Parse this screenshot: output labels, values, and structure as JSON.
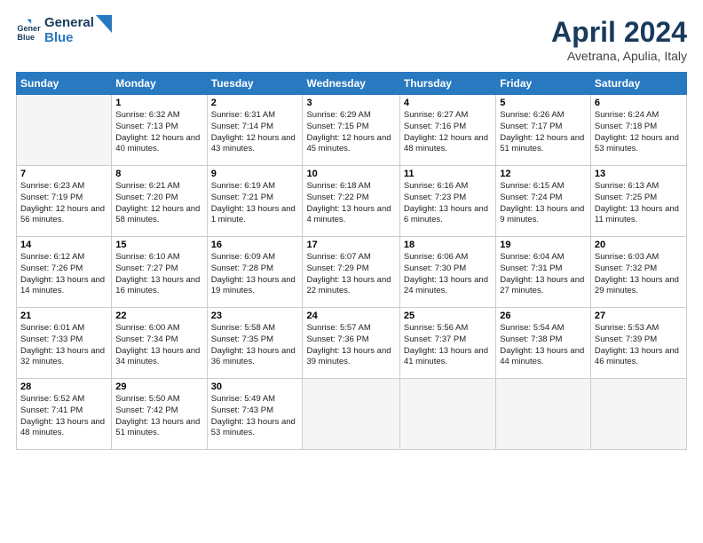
{
  "header": {
    "logo_line1": "General",
    "logo_line2": "Blue",
    "month": "April 2024",
    "location": "Avetrana, Apulia, Italy"
  },
  "columns": [
    "Sunday",
    "Monday",
    "Tuesday",
    "Wednesday",
    "Thursday",
    "Friday",
    "Saturday"
  ],
  "weeks": [
    [
      {
        "num": "",
        "sunrise": "",
        "sunset": "",
        "daylight": ""
      },
      {
        "num": "1",
        "sunrise": "Sunrise: 6:32 AM",
        "sunset": "Sunset: 7:13 PM",
        "daylight": "Daylight: 12 hours and 40 minutes."
      },
      {
        "num": "2",
        "sunrise": "Sunrise: 6:31 AM",
        "sunset": "Sunset: 7:14 PM",
        "daylight": "Daylight: 12 hours and 43 minutes."
      },
      {
        "num": "3",
        "sunrise": "Sunrise: 6:29 AM",
        "sunset": "Sunset: 7:15 PM",
        "daylight": "Daylight: 12 hours and 45 minutes."
      },
      {
        "num": "4",
        "sunrise": "Sunrise: 6:27 AM",
        "sunset": "Sunset: 7:16 PM",
        "daylight": "Daylight: 12 hours and 48 minutes."
      },
      {
        "num": "5",
        "sunrise": "Sunrise: 6:26 AM",
        "sunset": "Sunset: 7:17 PM",
        "daylight": "Daylight: 12 hours and 51 minutes."
      },
      {
        "num": "6",
        "sunrise": "Sunrise: 6:24 AM",
        "sunset": "Sunset: 7:18 PM",
        "daylight": "Daylight: 12 hours and 53 minutes."
      }
    ],
    [
      {
        "num": "7",
        "sunrise": "Sunrise: 6:23 AM",
        "sunset": "Sunset: 7:19 PM",
        "daylight": "Daylight: 12 hours and 56 minutes."
      },
      {
        "num": "8",
        "sunrise": "Sunrise: 6:21 AM",
        "sunset": "Sunset: 7:20 PM",
        "daylight": "Daylight: 12 hours and 58 minutes."
      },
      {
        "num": "9",
        "sunrise": "Sunrise: 6:19 AM",
        "sunset": "Sunset: 7:21 PM",
        "daylight": "Daylight: 13 hours and 1 minute."
      },
      {
        "num": "10",
        "sunrise": "Sunrise: 6:18 AM",
        "sunset": "Sunset: 7:22 PM",
        "daylight": "Daylight: 13 hours and 4 minutes."
      },
      {
        "num": "11",
        "sunrise": "Sunrise: 6:16 AM",
        "sunset": "Sunset: 7:23 PM",
        "daylight": "Daylight: 13 hours and 6 minutes."
      },
      {
        "num": "12",
        "sunrise": "Sunrise: 6:15 AM",
        "sunset": "Sunset: 7:24 PM",
        "daylight": "Daylight: 13 hours and 9 minutes."
      },
      {
        "num": "13",
        "sunrise": "Sunrise: 6:13 AM",
        "sunset": "Sunset: 7:25 PM",
        "daylight": "Daylight: 13 hours and 11 minutes."
      }
    ],
    [
      {
        "num": "14",
        "sunrise": "Sunrise: 6:12 AM",
        "sunset": "Sunset: 7:26 PM",
        "daylight": "Daylight: 13 hours and 14 minutes."
      },
      {
        "num": "15",
        "sunrise": "Sunrise: 6:10 AM",
        "sunset": "Sunset: 7:27 PM",
        "daylight": "Daylight: 13 hours and 16 minutes."
      },
      {
        "num": "16",
        "sunrise": "Sunrise: 6:09 AM",
        "sunset": "Sunset: 7:28 PM",
        "daylight": "Daylight: 13 hours and 19 minutes."
      },
      {
        "num": "17",
        "sunrise": "Sunrise: 6:07 AM",
        "sunset": "Sunset: 7:29 PM",
        "daylight": "Daylight: 13 hours and 22 minutes."
      },
      {
        "num": "18",
        "sunrise": "Sunrise: 6:06 AM",
        "sunset": "Sunset: 7:30 PM",
        "daylight": "Daylight: 13 hours and 24 minutes."
      },
      {
        "num": "19",
        "sunrise": "Sunrise: 6:04 AM",
        "sunset": "Sunset: 7:31 PM",
        "daylight": "Daylight: 13 hours and 27 minutes."
      },
      {
        "num": "20",
        "sunrise": "Sunrise: 6:03 AM",
        "sunset": "Sunset: 7:32 PM",
        "daylight": "Daylight: 13 hours and 29 minutes."
      }
    ],
    [
      {
        "num": "21",
        "sunrise": "Sunrise: 6:01 AM",
        "sunset": "Sunset: 7:33 PM",
        "daylight": "Daylight: 13 hours and 32 minutes."
      },
      {
        "num": "22",
        "sunrise": "Sunrise: 6:00 AM",
        "sunset": "Sunset: 7:34 PM",
        "daylight": "Daylight: 13 hours and 34 minutes."
      },
      {
        "num": "23",
        "sunrise": "Sunrise: 5:58 AM",
        "sunset": "Sunset: 7:35 PM",
        "daylight": "Daylight: 13 hours and 36 minutes."
      },
      {
        "num": "24",
        "sunrise": "Sunrise: 5:57 AM",
        "sunset": "Sunset: 7:36 PM",
        "daylight": "Daylight: 13 hours and 39 minutes."
      },
      {
        "num": "25",
        "sunrise": "Sunrise: 5:56 AM",
        "sunset": "Sunset: 7:37 PM",
        "daylight": "Daylight: 13 hours and 41 minutes."
      },
      {
        "num": "26",
        "sunrise": "Sunrise: 5:54 AM",
        "sunset": "Sunset: 7:38 PM",
        "daylight": "Daylight: 13 hours and 44 minutes."
      },
      {
        "num": "27",
        "sunrise": "Sunrise: 5:53 AM",
        "sunset": "Sunset: 7:39 PM",
        "daylight": "Daylight: 13 hours and 46 minutes."
      }
    ],
    [
      {
        "num": "28",
        "sunrise": "Sunrise: 5:52 AM",
        "sunset": "Sunset: 7:41 PM",
        "daylight": "Daylight: 13 hours and 48 minutes."
      },
      {
        "num": "29",
        "sunrise": "Sunrise: 5:50 AM",
        "sunset": "Sunset: 7:42 PM",
        "daylight": "Daylight: 13 hours and 51 minutes."
      },
      {
        "num": "30",
        "sunrise": "Sunrise: 5:49 AM",
        "sunset": "Sunset: 7:43 PM",
        "daylight": "Daylight: 13 hours and 53 minutes."
      },
      {
        "num": "",
        "sunrise": "",
        "sunset": "",
        "daylight": ""
      },
      {
        "num": "",
        "sunrise": "",
        "sunset": "",
        "daylight": ""
      },
      {
        "num": "",
        "sunrise": "",
        "sunset": "",
        "daylight": ""
      },
      {
        "num": "",
        "sunrise": "",
        "sunset": "",
        "daylight": ""
      }
    ]
  ]
}
